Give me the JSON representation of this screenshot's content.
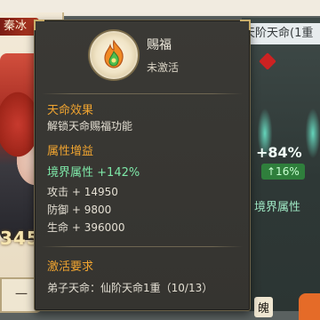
{
  "background": {
    "left_card_name": "秦冰",
    "left_power": "345",
    "left_bottom_text": "一",
    "right_banner": "天阶天命(1重",
    "right_stat": "+84%",
    "right_badge": "↑16%",
    "right_label": "境界属性",
    "right_bottom_text": "魄"
  },
  "tooltip": {
    "skill_icon": "flame-blessing-icon",
    "skill_name": "赐福",
    "skill_status": "未激活",
    "effect_section": {
      "title": "天命效果",
      "description": "解锁天命赐福功能"
    },
    "bonus_section": {
      "title": "属性增益",
      "attr_name": "境界属性",
      "attr_value": "+142%",
      "stats": [
        {
          "label": "攻击",
          "value": "+ 14950"
        },
        {
          "label": "防御",
          "value": "+ 9800"
        },
        {
          "label": "生命",
          "value": "+ 396000"
        }
      ]
    },
    "requirement_section": {
      "title": "激活要求",
      "requirement": "弟子天命：仙阶天命1重（10/13）"
    }
  },
  "colors": {
    "panel_bg": "#363531",
    "section_title": "#f0a430",
    "attr_green": "#7ee8a8",
    "text": "#e4dfd3"
  }
}
